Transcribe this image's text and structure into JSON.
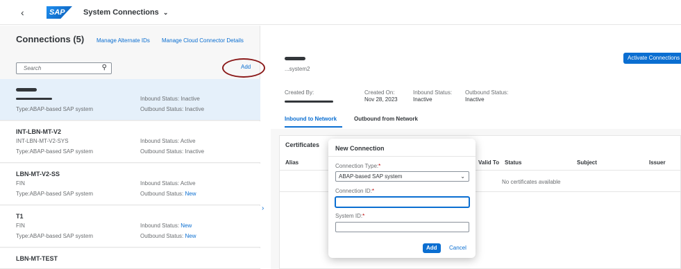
{
  "shell": {
    "back_glyph": "‹",
    "logo": "SAP",
    "title": "System Connections",
    "title_chevron": "⌄"
  },
  "left": {
    "title": "Connections (5)",
    "manage_alt_ids": "Manage Alternate IDs",
    "manage_cloud": "Manage Cloud Connector Details",
    "search_placeholder": "Search",
    "search_icon": "⚲",
    "add": "Add",
    "items": [
      {
        "name": "",
        "system": "",
        "type": "Type:ABAP-based SAP system",
        "inbound": "Inbound Status: Inactive",
        "outbound_prefix": "Outbound Status: ",
        "outbound": "Inactive"
      },
      {
        "name": "INT-LBN-MT-V2",
        "system": "INT-LBN-MT-V2-SYS",
        "type": "Type:ABAP-based SAP system",
        "inbound": "Inbound Status: Active",
        "outbound_prefix": "Outbound Status: ",
        "outbound": "Inactive"
      },
      {
        "name": "LBN-MT-V2-SS",
        "system": "FIN",
        "type": "Type:ABAP-based SAP system",
        "inbound": "Inbound Status: Active",
        "outbound_prefix": "Outbound Status: ",
        "outbound": "New"
      },
      {
        "name": "T1",
        "system": "FIN",
        "type": "Type:ABAP-based SAP system",
        "inbound_prefix": "Inbound Status: ",
        "inbound": "New",
        "outbound_prefix": "Outbound Status: ",
        "outbound": "New"
      },
      {
        "name": "LBN-MT-TEST"
      }
    ]
  },
  "right": {
    "activate": "Activate Connections",
    "header_sub": "...system2",
    "created_by_label": "Created By:",
    "created_on_label": "Created On:",
    "created_on_value": "Nov 28, 2023",
    "inbound_label": "Inbound Status:",
    "inbound_value": "Inactive",
    "outbound_label": "Outbound Status:",
    "outbound_value": "Inactive",
    "tab_inbound": "Inbound to Network",
    "tab_outbound": "Outbound from Network",
    "cert_title": "Certificates",
    "col_alias": "Alias",
    "col_valid_to": "Valid To",
    "col_status": "Status",
    "col_subject": "Subject",
    "col_issuer": "Issuer",
    "no_certs": "No certificates available",
    "collapse_glyph": "›"
  },
  "dialog": {
    "title": "New Connection",
    "conn_type_label": "Connection Type:",
    "conn_type_value": "ABAP-based SAP system",
    "dropdown_glyph": "⌄",
    "conn_id_label": "Connection ID:",
    "system_id_label": "System ID:",
    "required_mark": "*",
    "add": "Add",
    "cancel": "Cancel"
  }
}
